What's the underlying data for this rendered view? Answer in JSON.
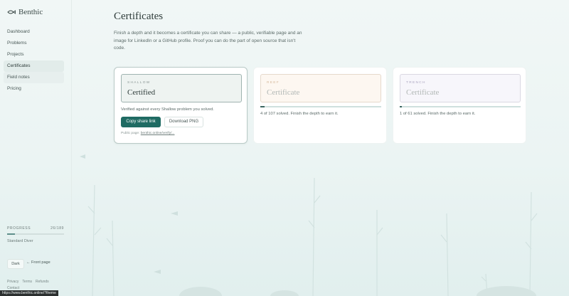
{
  "app": {
    "name": "Benthic",
    "logo_icon": "fish-icon"
  },
  "sidebar": {
    "items": [
      {
        "label": "Dashboard",
        "active": false
      },
      {
        "label": "Problems",
        "active": false
      },
      {
        "label": "Projects",
        "active": false
      },
      {
        "label": "Certificates",
        "active": true
      },
      {
        "label": "Field notes",
        "active": false
      },
      {
        "label": "Pricing",
        "active": false
      }
    ],
    "progress": {
      "label": "PROGRESS",
      "count": "26/189",
      "fraction": 0.138
    },
    "rank": "Standard Diver",
    "dark_label": "Dark",
    "front_page_label": "← Front page",
    "footer": {
      "privacy": "Privacy",
      "terms": "Terms",
      "refunds": "Refunds",
      "contact": "Contact"
    }
  },
  "main": {
    "title": "Certificates",
    "intro": "Finish a depth and it becomes a certificate you can share — a public, verifiable page and an image for LinkedIn or a GitHub profile. Proof you can do the part of open source that isn't code."
  },
  "cards": [
    {
      "tier": "SHALLOW",
      "name": "Certified",
      "status_text": "Verified against every Shallow problem you solved.",
      "copy_label": "Copy share link",
      "download_label": "Download PNG",
      "public_prefix": "Public page:",
      "public_link": "benthic.online/verify/..."
    },
    {
      "tier": "REEF",
      "name": "Certificate",
      "progress_fraction": 0.037,
      "status_text": "4 of 107 solved. Finish the depth to earn it."
    },
    {
      "tier": "TRENCH",
      "name": "Certificate",
      "progress_fraction": 0.016,
      "status_text": "1 of 61 solved. Finish the depth to earn it."
    }
  ],
  "status_bar": {
    "url": "https://www.benthic.online/?theme"
  },
  "colors": {
    "accent": "#1f6b63",
    "progress": "#3c6662"
  }
}
